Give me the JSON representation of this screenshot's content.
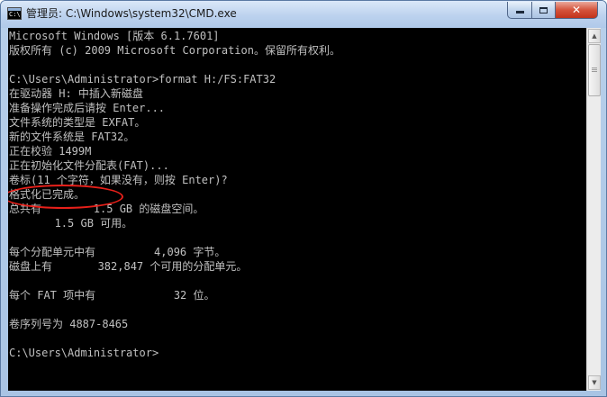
{
  "window": {
    "title": "管理员: C:\\Windows\\system32\\CMD.exe",
    "icon": "cmd-console-icon",
    "icon_text": "C:\\",
    "controls": {
      "minimize": "minimize-icon",
      "maximize": "maximize-icon",
      "close_label": "✕"
    }
  },
  "console": {
    "text_color": "#c0c0c0",
    "background": "#000000",
    "lines": [
      "Microsoft Windows [版本 6.1.7601]",
      "版权所有 (c) 2009 Microsoft Corporation。保留所有权利。",
      "",
      "C:\\Users\\Administrator>format H:/FS:FAT32",
      "在驱动器 H: 中插入新磁盘",
      "准备操作完成后请按 Enter...",
      "文件系统的类型是 EXFAT。",
      "新的文件系统是 FAT32。",
      "正在校验 1499M",
      "正在初始化文件分配表(FAT)...",
      "卷标(11 个字符，如果没有，则按 Enter)?",
      "格式化已完成。",
      "总共有        1.5 GB 的磁盘空间。",
      "       1.5 GB 可用。",
      "",
      "每个分配单元中有         4,096 字节。",
      "磁盘上有       382,847 个可用的分配单元。",
      "",
      "每个 FAT 项中有            32 位。",
      "",
      "卷序列号为 4887-8465",
      "",
      "C:\\Users\\Administrator>"
    ],
    "highlight_color": "#e8201a"
  },
  "scrollbar": {
    "up_arrow": "▲",
    "down_arrow": "▼"
  }
}
